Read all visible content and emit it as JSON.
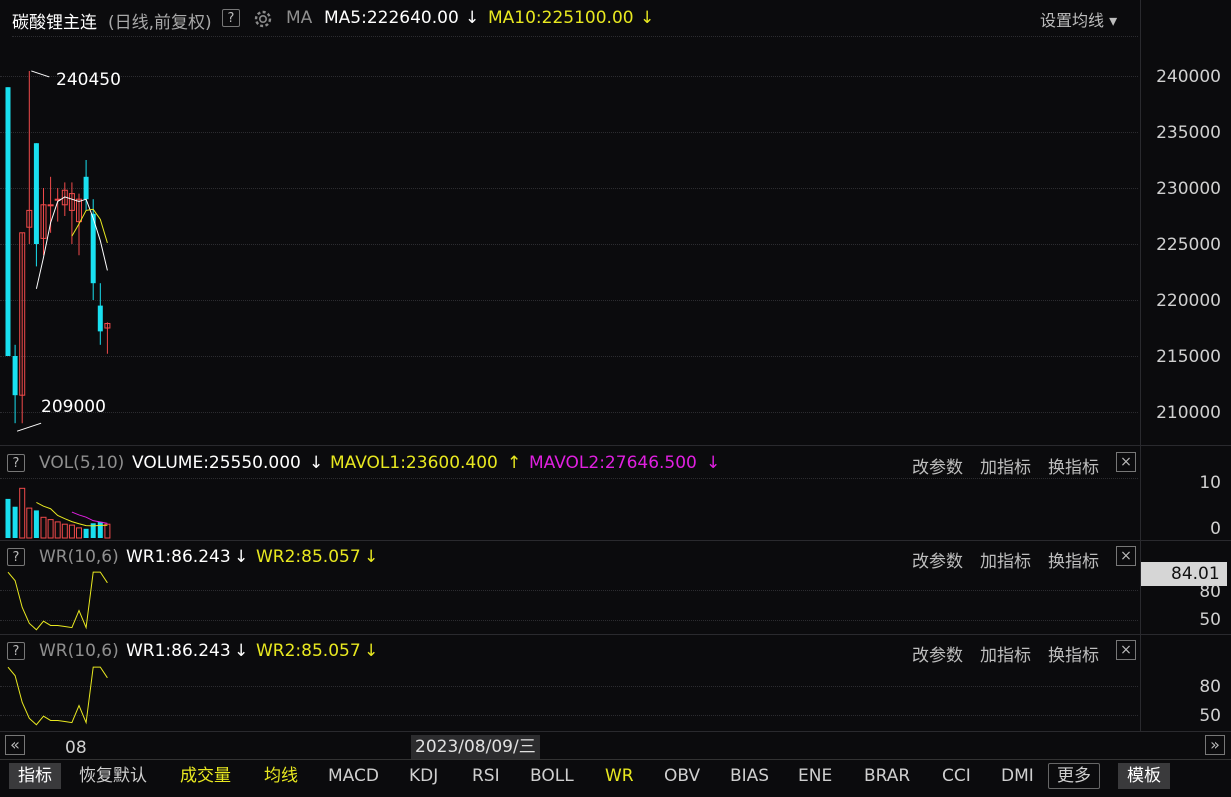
{
  "header": {
    "title": "碳酸锂主连",
    "period": "(日线,前复权)",
    "help": "?",
    "ma_label": "MA",
    "ma5": "MA5:222640.00",
    "ma10": "MA10:225100.00",
    "arrow_down": "↓",
    "arrow_up": "↑",
    "settings": "设置均线 ▾"
  },
  "main_axis": [
    "240000",
    "235000",
    "230000",
    "225000",
    "220000",
    "215000",
    "210000"
  ],
  "annotations": {
    "high": "240450",
    "low": "209000"
  },
  "vol_panel": {
    "help": "?",
    "name": "VOL(5,10)",
    "volume": "VOLUME:25550.000",
    "mavol1": "MAVOL1:23600.400",
    "mavol2": "MAVOL2:27646.500",
    "axis": [
      "10",
      "0"
    ]
  },
  "wr_panel1": {
    "help": "?",
    "name": "WR(10,6)",
    "wr1": "WR1:86.243",
    "wr2": "WR2:85.057",
    "axis": [
      "80",
      "50"
    ],
    "current": "84.01"
  },
  "wr_panel2": {
    "help": "?",
    "name": "WR(10,6)",
    "wr1": "WR1:86.243",
    "wr2": "WR2:85.057",
    "axis": [
      "80",
      "50"
    ]
  },
  "panel_actions": {
    "modify": "改参数",
    "add": "加指标",
    "replace": "换指标",
    "close": "×"
  },
  "timeline": {
    "scroll_left": "«",
    "scroll_right": "»",
    "month": "08",
    "cursor_date": "2023/08/09/三"
  },
  "toolbar": [
    "指标",
    "恢复默认",
    "成交量",
    "均线",
    "MACD",
    "KDJ",
    "RSI",
    "BOLL",
    "WR",
    "OBV",
    "BIAS",
    "ENE",
    "BRAR",
    "CCI",
    "DMI",
    "更多",
    "模板"
  ],
  "colors": {
    "up": "#f04a4a",
    "down": "#19e0f0",
    "ma5": "#ffffff",
    "ma10": "#e8e820",
    "mavol2": "#e020e0",
    "bg": "#0b0b0d"
  },
  "chart_data": [
    {
      "type": "candlestick",
      "title": "碳酸锂主连",
      "y_axis_ticks": [
        240000,
        235000,
        230000,
        225000,
        220000,
        215000,
        210000
      ],
      "ylim": [
        207500,
        243000
      ],
      "bars": [
        {
          "o": 239000,
          "h": 239000,
          "l": 215000,
          "c": 215000
        },
        {
          "o": 215000,
          "h": 216000,
          "l": 209000,
          "c": 211500
        },
        {
          "o": 211500,
          "h": 226000,
          "l": 209000,
          "c": 226000
        },
        {
          "o": 226500,
          "h": 240450,
          "l": 225000,
          "c": 228000
        },
        {
          "o": 234000,
          "h": 234000,
          "l": 223000,
          "c": 225000
        },
        {
          "o": 225500,
          "h": 230000,
          "l": 224000,
          "c": 228500
        },
        {
          "o": 228500,
          "h": 231000,
          "l": 226000,
          "c": 228500
        },
        {
          "o": 229000,
          "h": 230000,
          "l": 227000,
          "c": 229000
        },
        {
          "o": 228500,
          "h": 230500,
          "l": 227500,
          "c": 229800
        },
        {
          "o": 228000,
          "h": 230500,
          "l": 225000,
          "c": 229500
        },
        {
          "o": 227000,
          "h": 229500,
          "l": 224000,
          "c": 229000
        },
        {
          "o": 231000,
          "h": 232500,
          "l": 228000,
          "c": 229000
        },
        {
          "o": 227700,
          "h": 229000,
          "l": 220000,
          "c": 221500
        },
        {
          "o": 219500,
          "h": 221500,
          "l": 216000,
          "c": 217200
        },
        {
          "o": 217500,
          "h": 218000,
          "l": 215200,
          "c": 217900
        }
      ],
      "ma5": [
        null,
        null,
        null,
        null,
        221000,
        223800,
        226900,
        228800,
        229200,
        229000,
        228800,
        229000,
        227300,
        225300,
        222640
      ],
      "ma10": [
        null,
        null,
        null,
        null,
        null,
        null,
        null,
        null,
        null,
        225700,
        226800,
        228000,
        228100,
        227200,
        225100
      ]
    },
    {
      "type": "bar",
      "title": "VOL(5,10)",
      "values": [
        8.5,
        6.8,
        10.8,
        6.5,
        6,
        4.5,
        4,
        3.5,
        3,
        2.8,
        2.2,
        2,
        3.2,
        3.5,
        3
      ],
      "ylim": [
        0,
        12
      ],
      "y_axis_ticks": [
        10,
        0
      ]
    },
    {
      "type": "line",
      "title": "WR(10,6)",
      "series": [
        {
          "name": "WR1",
          "values": [
            98,
            90,
            65,
            50,
            44,
            52,
            48,
            48,
            47,
            46,
            62,
            46,
            98,
            98,
            88
          ]
        }
      ],
      "y_axis_ticks": [
        80,
        50
      ]
    }
  ]
}
